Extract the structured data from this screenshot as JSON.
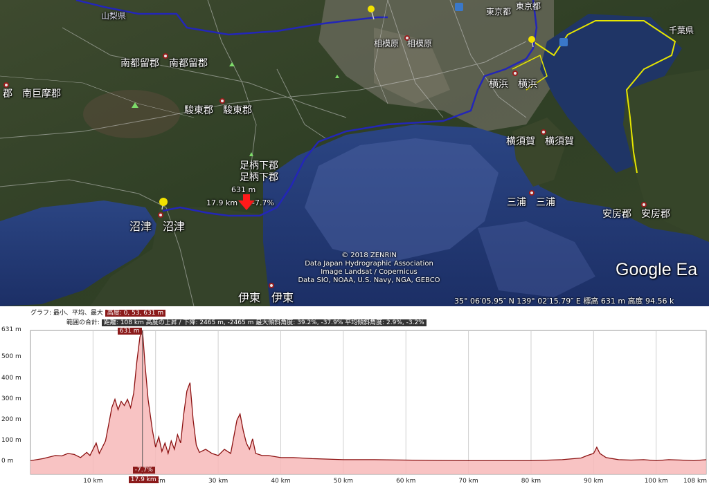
{
  "map": {
    "places": [
      {
        "id": "yamanashi",
        "text": "山梨県"
      },
      {
        "id": "tokyo",
        "text": "東京都"
      },
      {
        "id": "tokyo2",
        "text": "東京都"
      },
      {
        "id": "chiba",
        "text": "千葉県"
      },
      {
        "id": "sagamihara",
        "text": "相模原　相模原"
      },
      {
        "id": "minamitsuru",
        "text": "南都留郡　南都留郡"
      },
      {
        "id": "minamikoma",
        "text": "郡　南巨摩郡"
      },
      {
        "id": "yokohama",
        "text": "横浜　横浜"
      },
      {
        "id": "sunto",
        "text": "駿東郡　駿東郡"
      },
      {
        "id": "yokosuka",
        "text": "横須賀　横須賀"
      },
      {
        "id": "ashigara1",
        "text": "足柄下郡"
      },
      {
        "id": "ashigara2",
        "text": "足柄下郡"
      },
      {
        "id": "miura",
        "text": "三浦　三浦"
      },
      {
        "id": "awa",
        "text": "安房郡　安房郡"
      },
      {
        "id": "numazu",
        "text": "沼津　沼津"
      },
      {
        "id": "ito",
        "text": "伊東　伊東"
      }
    ],
    "cursor": {
      "elevation": "631 m",
      "distance": "17.9 km",
      "grade": "-7.7%"
    },
    "credits": [
      "© 2018 ZENRIN",
      "Data Japan Hydrographic Association",
      "Image Landsat / Copernicus",
      "Data SIO, NOAA, U.S. Navy, NGA, GEBCO"
    ],
    "logo": "Google Ea",
    "status": "35° 06′05.95″ N  139° 02′15.79″ E  標高    631 m    高度  94.56 k"
  },
  "profile": {
    "header1_label": "グラフ: 最小、平均、最大",
    "header1_value": "高度: 0, 53, 631 m",
    "header2_label": "範囲の合計:",
    "header2_value": "距離: 108 km  高度の上昇 / 下降: 2465 m, -2465 m  最大傾斜角度: 39.2%, -37.9%  平均傾斜角度: 2.9%, -3.2%",
    "cursor_elev": "631 m",
    "cursor_grade": "-7.7%",
    "cursor_dist": "17.9 km"
  },
  "chart_data": {
    "type": "area",
    "xlabel": "",
    "ylabel": "",
    "x_ticks": [
      "10 km",
      "20 km",
      "30 km",
      "40 km",
      "50 km",
      "60 km",
      "70 km",
      "80 km",
      "90 km",
      "100 km",
      "108 km"
    ],
    "y_ticks": [
      "0 m",
      "100 m",
      "200 m",
      "300 m",
      "400 m",
      "500 m",
      "631 m"
    ],
    "xlim": [
      0,
      108
    ],
    "ylim": [
      -60,
      631
    ],
    "x": [
      0,
      2,
      4,
      5,
      6,
      7,
      8,
      9,
      9.5,
      10,
      10.5,
      11,
      12,
      12.5,
      13,
      13.5,
      14,
      14.5,
      15,
      15.5,
      16,
      16.5,
      17,
      17.5,
      17.9,
      18.3,
      18.8,
      19.5,
      20,
      20.5,
      21,
      21.5,
      22,
      22.5,
      23,
      23.5,
      24,
      24.5,
      25,
      25.5,
      26,
      26.5,
      27,
      28,
      29,
      30,
      31,
      32,
      32.5,
      33,
      33.5,
      34,
      34.5,
      35,
      35.5,
      36,
      37,
      38,
      39,
      40,
      42,
      45,
      50,
      55,
      60,
      65,
      70,
      75,
      80,
      85,
      88,
      89,
      90,
      90.5,
      91,
      92,
      94,
      96,
      98,
      100,
      102,
      104,
      106,
      108
    ],
    "y": [
      5,
      15,
      30,
      28,
      40,
      35,
      20,
      45,
      30,
      60,
      90,
      40,
      100,
      180,
      260,
      300,
      250,
      290,
      270,
      300,
      260,
      330,
      480,
      600,
      631,
      470,
      300,
      150,
      70,
      120,
      50,
      90,
      40,
      100,
      60,
      130,
      90,
      230,
      340,
      380,
      200,
      80,
      45,
      60,
      40,
      30,
      60,
      40,
      120,
      200,
      230,
      150,
      90,
      60,
      110,
      40,
      30,
      30,
      25,
      20,
      20,
      15,
      10,
      10,
      8,
      6,
      5,
      5,
      5,
      10,
      18,
      30,
      40,
      70,
      40,
      20,
      10,
      8,
      10,
      5,
      10,
      8,
      5,
      10
    ]
  }
}
